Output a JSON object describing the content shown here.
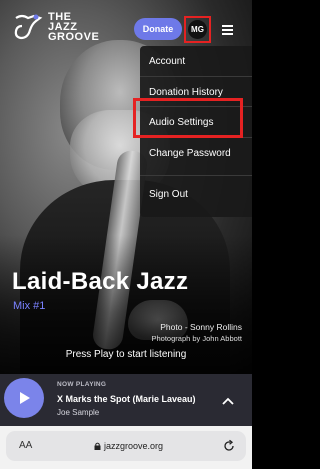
{
  "header": {
    "logo_line1": "THE",
    "logo_line2": "JAZZ",
    "logo_line3": "GROOVE",
    "donate_label": "Donate",
    "avatar_initials": "MG",
    "menu_icon": "hamburger-icon"
  },
  "account_menu": {
    "items": [
      {
        "label": "Account"
      },
      {
        "label": "Donation History"
      },
      {
        "label": "Audio Settings"
      },
      {
        "label": "Change Password"
      },
      {
        "label": "Sign Out"
      }
    ]
  },
  "hero": {
    "title": "Laid-Back Jazz",
    "mix": "Mix #1",
    "photo_credit": "Photo - Sonny Rollins",
    "photographer": "Photograph by John Abbott",
    "prompt": "Press Play to start listening"
  },
  "player": {
    "now_playing_label": "NOW PLAYING",
    "track": "X Marks the Spot (Marie Laveau)",
    "artist": "Joe Sample",
    "play_icon": "play-icon",
    "expand_icon": "chevron-up-icon",
    "accent": "#7b84ea"
  },
  "browser": {
    "text_size_label": "AA",
    "url": "jazzgroove.org",
    "lock_icon": "lock-icon",
    "reload_icon": "reload-icon"
  },
  "colors": {
    "brand_purple": "#6e79e8",
    "highlight_red": "#e52222"
  }
}
